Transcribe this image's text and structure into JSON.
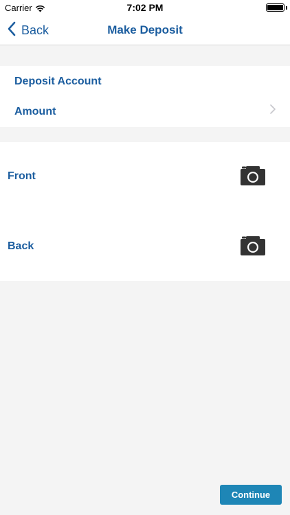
{
  "status_bar": {
    "carrier": "Carrier",
    "time": "7:02 PM",
    "battery_level": 1.0
  },
  "nav": {
    "back_label": "Back",
    "title": "Make Deposit"
  },
  "account_section": {
    "deposit_account_label": "Deposit Account",
    "amount_label": "Amount"
  },
  "check_images": {
    "front_label": "Front",
    "back_label": "Back"
  },
  "footer": {
    "continue_label": "Continue"
  },
  "colors": {
    "accent": "#1b5d9f",
    "button": "#1e86b6",
    "background": "#f4f4f4",
    "icon": "#333333"
  },
  "icons": {
    "back": "chevron-left-icon",
    "disclosure": "chevron-right-icon",
    "capture": "camera-icon",
    "wifi": "wifi-icon",
    "battery": "battery-icon"
  }
}
